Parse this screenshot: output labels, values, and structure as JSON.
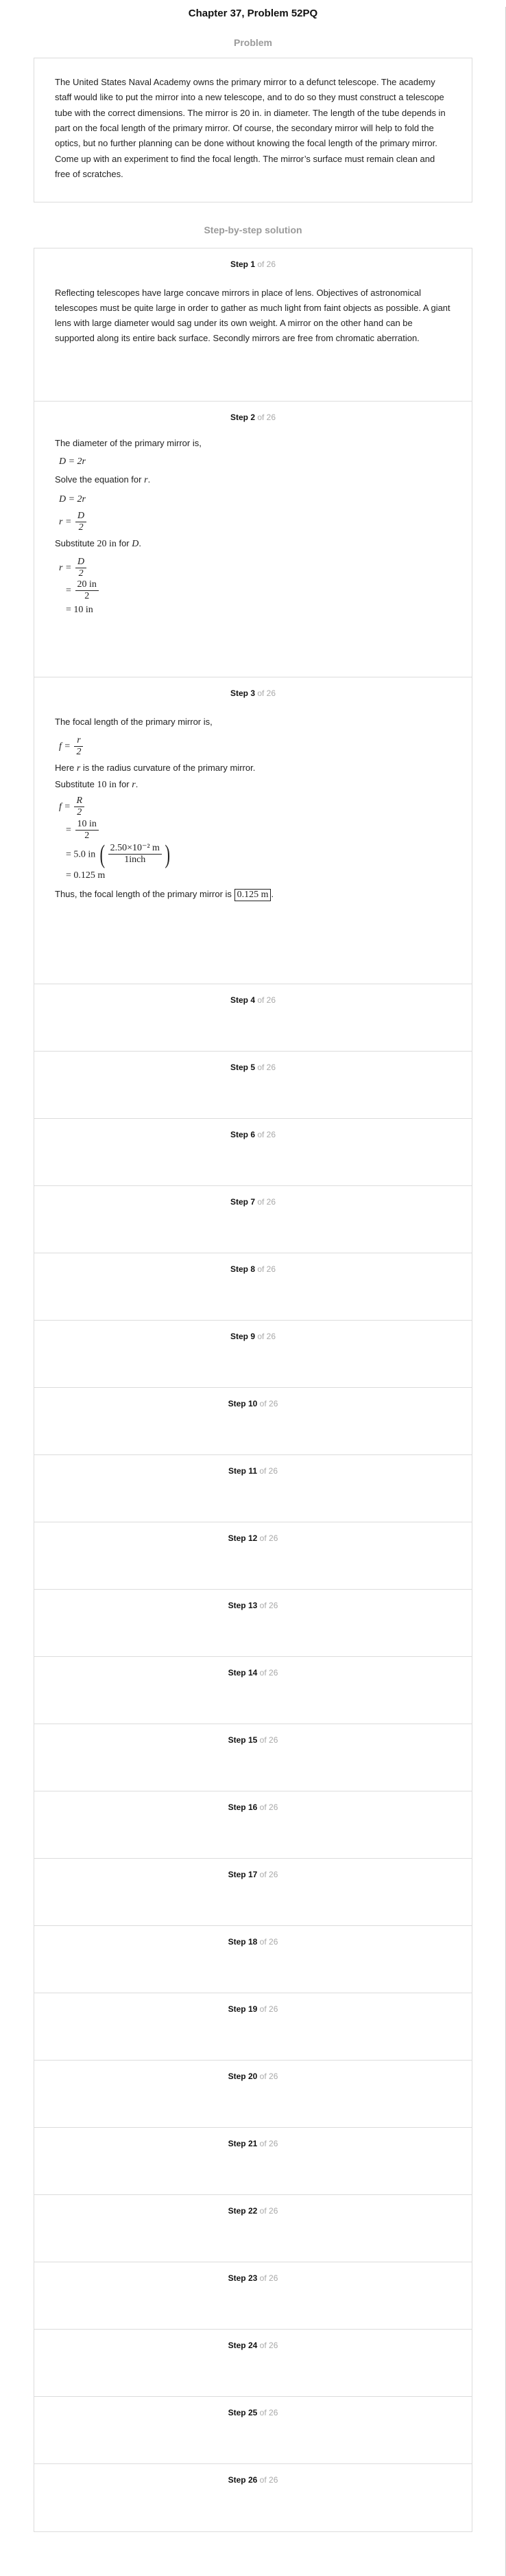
{
  "header": {
    "title": "Chapter 37, Problem 52PQ"
  },
  "problem": {
    "label": "Problem",
    "text": "The United States Naval Academy owns the primary mirror to a defunct telescope. The academy staff would like to put the mirror into a new telescope, and to do so they must construct a telescope tube with the correct dimensions. The mirror is 20 in. in diameter. The length of the tube depends in part on the focal length of the primary mirror. Of course, the secondary mirror will help to fold the optics, but no further planning can be done without knowing the focal length of the primary mirror. Come up with an experiment to find the focal length. The mirror’s surface must remain clean and free of scratches."
  },
  "solution": {
    "label": "Step-by-step solution",
    "step_word": "Step",
    "of_text": "of 26",
    "steps": [
      {
        "number": "1"
      },
      {
        "number": "2"
      },
      {
        "number": "3"
      },
      {
        "number": "4"
      },
      {
        "number": "5"
      },
      {
        "number": "6"
      },
      {
        "number": "7"
      },
      {
        "number": "8"
      },
      {
        "number": "9"
      },
      {
        "number": "10"
      },
      {
        "number": "11"
      },
      {
        "number": "12"
      },
      {
        "number": "13"
      },
      {
        "number": "14"
      },
      {
        "number": "15"
      },
      {
        "number": "16"
      },
      {
        "number": "17"
      },
      {
        "number": "18"
      },
      {
        "number": "19"
      },
      {
        "number": "20"
      },
      {
        "number": "21"
      },
      {
        "number": "22"
      },
      {
        "number": "23"
      },
      {
        "number": "24"
      },
      {
        "number": "25"
      },
      {
        "number": "26"
      }
    ],
    "step1": {
      "text": "Reflecting telescopes have large concave mirrors in place of lens. Objectives of astronomical telescopes must be quite large in order to gather as much light from faint objects as possible. A giant lens with large diameter would sag under its own weight. A mirror on the other hand can be supported along its entire back surface. Secondly mirrors are free from chromatic aberration."
    },
    "step2": {
      "intro": "The diameter of the primary mirror is,",
      "eq1": "D = 2r",
      "solve_pre": "Solve the equation for",
      "solve_var": "r",
      "solve_post": ".",
      "eq2": "D = 2r",
      "eq3_lhs": "r =",
      "eq3_num": "D",
      "eq3_den": "2",
      "subst_pre": "Substitute",
      "subst_val": "20 in",
      "subst_mid": "for",
      "subst_var": "D",
      "subst_post": ".",
      "calc_lhs": "r =",
      "calc1_num": "D",
      "calc1_den": "2",
      "calc2_eq": "=",
      "calc2_num": "20 in",
      "calc2_den": "2",
      "calc3": "= 10 in"
    },
    "step3": {
      "intro": "The focal length of the primary mirror is,",
      "eq_lhs": "f =",
      "eq_num": "r",
      "eq_den": "2",
      "here_pre": "Here",
      "here_var": "r",
      "here_post": "is the radius curvature of the primary mirror.",
      "subst_pre": "Substitute",
      "subst_val": "10 in",
      "subst_mid": "for",
      "subst_var": "r",
      "subst_post": ".",
      "c_lhs": "f =",
      "c1_num": "R",
      "c1_den": "2",
      "c2_eq": "=",
      "c2_num": "10 in",
      "c2_den": "2",
      "c3_pre": "= 5.0 in",
      "c3_num": "2.50×10⁻² m",
      "c3_den": "1inch",
      "c4": "= 0.125 m",
      "result_pre": "Thus, the focal length of the primary mirror is",
      "result_val": "0.125 m",
      "result_post": "."
    }
  }
}
